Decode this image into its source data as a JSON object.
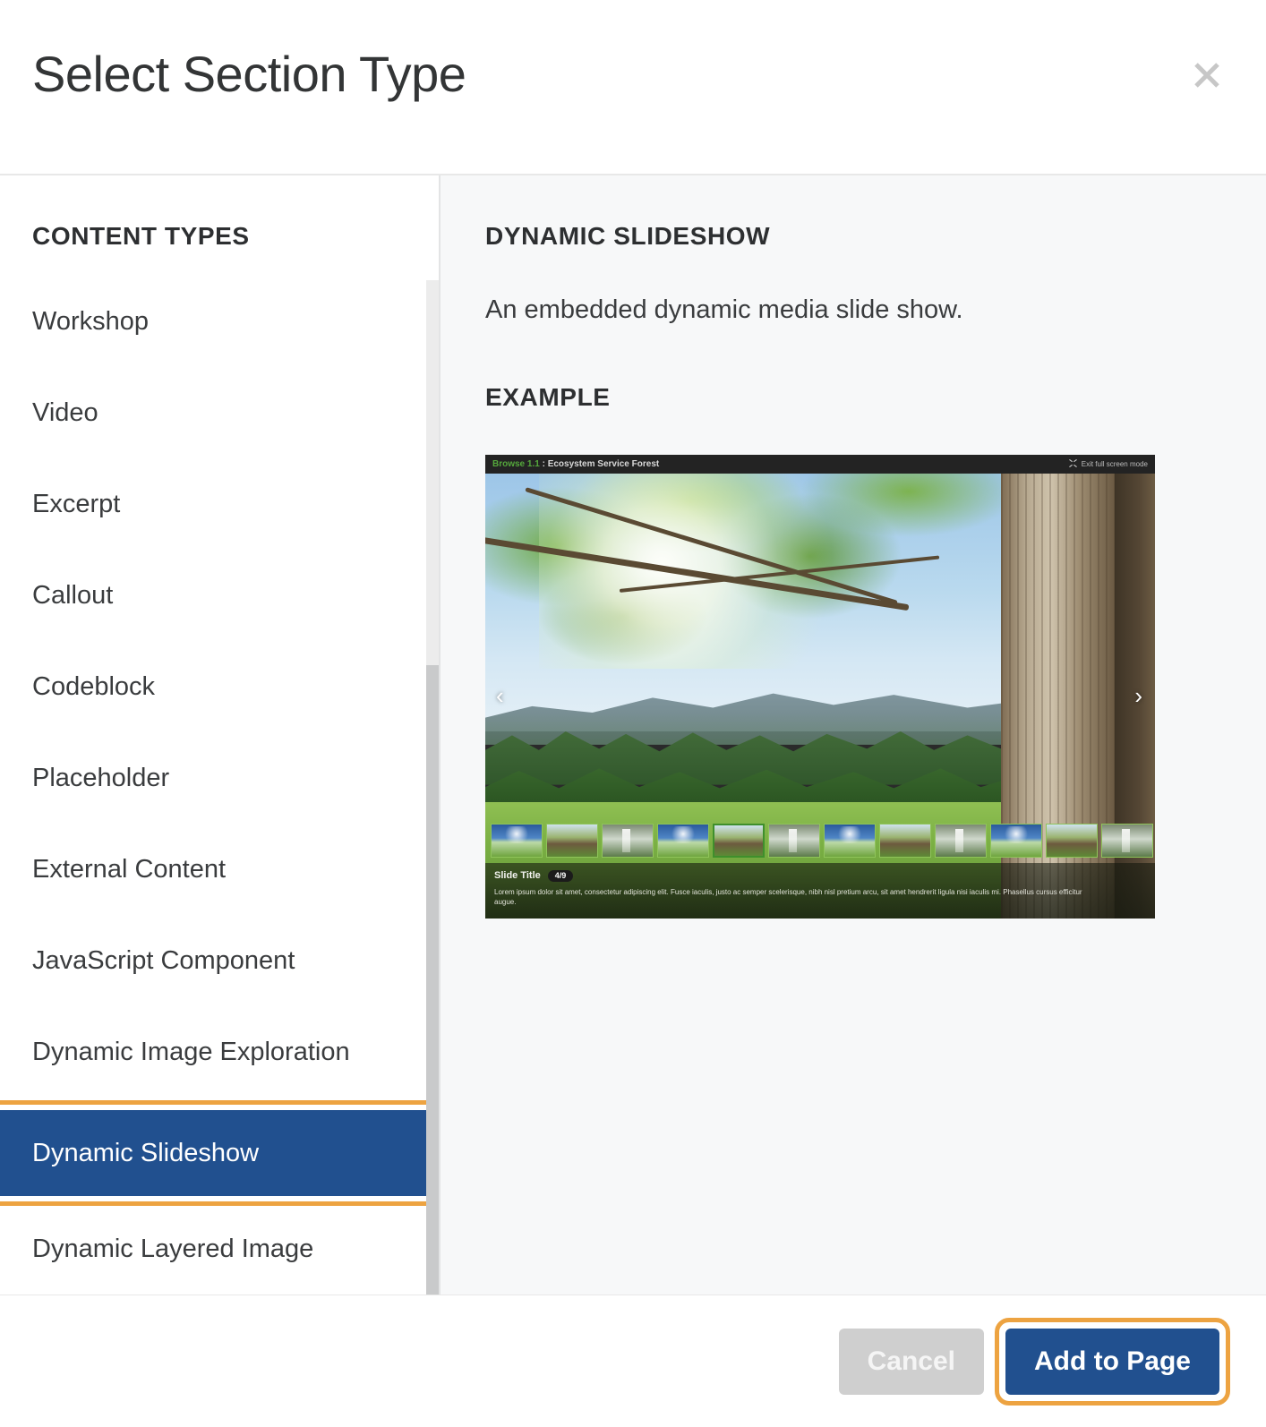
{
  "dialog": {
    "title": "Select Section Type",
    "close_icon": "close-icon"
  },
  "sidebar": {
    "heading": "CONTENT TYPES",
    "items": [
      {
        "label": "Workshop",
        "selected": false
      },
      {
        "label": "Video",
        "selected": false
      },
      {
        "label": "Excerpt",
        "selected": false
      },
      {
        "label": "Callout",
        "selected": false
      },
      {
        "label": "Codeblock",
        "selected": false
      },
      {
        "label": "Placeholder",
        "selected": false
      },
      {
        "label": "External Content",
        "selected": false
      },
      {
        "label": "JavaScript Component",
        "selected": false
      },
      {
        "label": "Dynamic Image Exploration",
        "selected": false
      },
      {
        "label": "Dynamic Slideshow",
        "selected": true
      },
      {
        "label": "Dynamic Layered Image",
        "selected": false
      }
    ]
  },
  "detail": {
    "title": "DYNAMIC SLIDESHOW",
    "description": "An embedded dynamic media slide show.",
    "example_label": "EXAMPLE",
    "example": {
      "topbar_left_version": "Browse 1.1",
      "topbar_left_rest": " : Ecosystem Service Forest",
      "topbar_right": "Exit full screen mode",
      "prev_arrow": "‹",
      "next_arrow": "›",
      "slide_title": "Slide Title",
      "slide_counter": "4/9",
      "slide_body": "Lorem ipsum dolor sit amet, consectetur adipiscing elit. Fusce iaculis, justo ac semper scelerisque, nibh nisl pretium arcu, sit amet hendrerit ligula nisi iaculis mi. Phasellus cursus efficitur augue."
    }
  },
  "footer": {
    "cancel_label": "Cancel",
    "primary_label": "Add to Page"
  },
  "colors": {
    "selected_blue": "#21508f",
    "annotation_orange": "#eda341",
    "panel_background": "#f7f8f9",
    "cancel_gray": "#cfcfcf",
    "scrollbar_track": "#ececec",
    "scrollbar_thumb": "#c9cacb",
    "version_green": "#55a83c"
  }
}
